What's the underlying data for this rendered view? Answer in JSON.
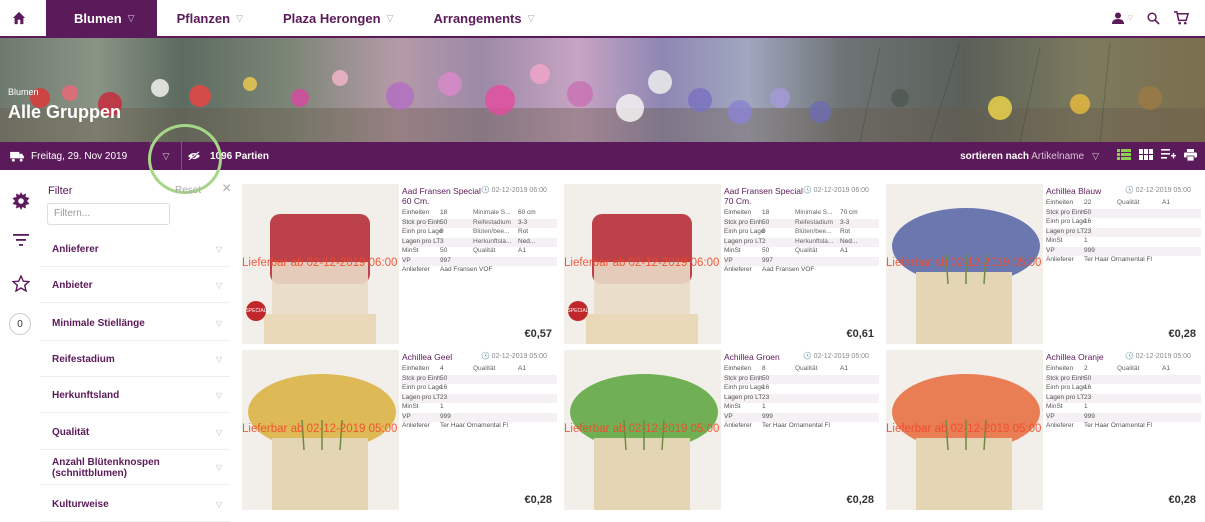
{
  "nav": {
    "items": [
      {
        "label": "Blumen",
        "active": true
      },
      {
        "label": "Pflanzen",
        "active": false
      },
      {
        "label": "Plaza Herongen",
        "active": false
      },
      {
        "label": "Arrangements",
        "active": false
      }
    ],
    "icons": [
      "home-icon",
      "user-icon",
      "search-icon",
      "cart-icon"
    ]
  },
  "banner": {
    "breadcrumb": "Blumen",
    "title": "Alle Gruppen"
  },
  "toolbar": {
    "date": "Freitag, 29. Nov 2019",
    "count": "1096 Partien",
    "sort_prefix": "sortieren nach",
    "sort_value": "Artikelname"
  },
  "filters": {
    "heading": "Filter",
    "reset": "Reset",
    "placeholder": "Filtern...",
    "badge": "0",
    "items": [
      "Anlieferer",
      "Anbieter",
      "Minimale Stiellänge",
      "Reifestadium",
      "Herkunftsland",
      "Qualität",
      "Anzahl Blütenknospen (schnittblumen)",
      "Kulturweise"
    ]
  },
  "products": [
    {
      "name": "Aad Fransen Special 60 Cm.",
      "date": "02-12-2019 06:00",
      "lieferbar": "Lieferbar ab 02-12-2019 06:00",
      "special": true,
      "rows": [
        [
          "Einheiten",
          "18",
          "Minimale S...",
          "60 cm"
        ],
        [
          "Stck pro Einh",
          "50",
          "Reifestadium",
          "3-3"
        ],
        [
          "Einh pro Lage",
          "9",
          "Blüten/bee...",
          "Rot"
        ],
        [
          "Lagen pro LT",
          "3",
          "Herkunftsla...",
          "Ned..."
        ],
        [
          "MinSt",
          "50",
          "Qualität",
          "A1"
        ],
        [
          "VP",
          "997",
          "",
          ""
        ]
      ],
      "anlieferer": "Aad Fransen VOF",
      "price": "€0,57"
    },
    {
      "name": "Aad Fransen Special 70 Cm.",
      "date": "02-12-2019 06:00",
      "lieferbar": "Lieferbar ab 02-12-2019 06:00",
      "special": true,
      "rows": [
        [
          "Einheiten",
          "18",
          "Minimale S...",
          "70 cm"
        ],
        [
          "Stck pro Einh",
          "50",
          "Reifestadium",
          "3-3"
        ],
        [
          "Einh pro Lage",
          "9",
          "Blüten/bee...",
          "Rot"
        ],
        [
          "Lagen pro LT",
          "2",
          "Herkunftsla...",
          "Ned..."
        ],
        [
          "MinSt",
          "50",
          "Qualität",
          "A1"
        ],
        [
          "VP",
          "997",
          "",
          ""
        ]
      ],
      "anlieferer": "Aad Fransen VOF",
      "price": "€0,61"
    },
    {
      "name": "Achillea Blauw",
      "date": "02-12-2019 05:00",
      "lieferbar": "Lieferbar ab 02-12-2019 05:00",
      "special": false,
      "rows": [
        [
          "Einheiten",
          "22",
          "Qualität",
          "A1"
        ],
        [
          "Stck pro Einh",
          "50",
          "",
          ""
        ],
        [
          "Einh pro Lage",
          "16",
          "",
          ""
        ],
        [
          "Lagen pro LT",
          "23",
          "",
          ""
        ],
        [
          "MinSt",
          "1",
          "",
          ""
        ],
        [
          "VP",
          "999",
          "",
          ""
        ]
      ],
      "anlieferer": "Ter Haar Ornamental Fl",
      "price": "€0,28"
    },
    {
      "name": "Achillea Geel",
      "date": "02-12-2019 05:00",
      "lieferbar": "Lieferbar ab 02-12-2019 05:00",
      "special": false,
      "rows": [
        [
          "Einheiten",
          "4",
          "Qualität",
          "A1"
        ],
        [
          "Stck pro Einh",
          "50",
          "",
          ""
        ],
        [
          "Einh pro Lage",
          "16",
          "",
          ""
        ],
        [
          "Lagen pro LT",
          "23",
          "",
          ""
        ],
        [
          "MinSt",
          "1",
          "",
          ""
        ],
        [
          "VP",
          "999",
          "",
          ""
        ]
      ],
      "anlieferer": "Ter Haar Ornamental Fl",
      "price": "€0,28"
    },
    {
      "name": "Achillea Groen",
      "date": "02-12-2019 05:00",
      "lieferbar": "Lieferbar ab 02-12-2019 05:00",
      "special": false,
      "rows": [
        [
          "Einheiten",
          "8",
          "Qualität",
          "A1"
        ],
        [
          "Stck pro Einh",
          "50",
          "",
          ""
        ],
        [
          "Einh pro Lage",
          "16",
          "",
          ""
        ],
        [
          "Lagen pro LT",
          "23",
          "",
          ""
        ],
        [
          "MinSt",
          "1",
          "",
          ""
        ],
        [
          "VP",
          "999",
          "",
          ""
        ]
      ],
      "anlieferer": "Ter Haar Ornamental Fl",
      "price": "€0,28"
    },
    {
      "name": "Achillea Oranje",
      "date": "02-12-2019 05:00",
      "lieferbar": "Lieferbar ab 02-12-2019 05:00",
      "special": false,
      "rows": [
        [
          "Einheiten",
          "2",
          "Qualität",
          "A1"
        ],
        [
          "Stck pro Einh",
          "50",
          "",
          ""
        ],
        [
          "Einh pro Lage",
          "16",
          "",
          ""
        ],
        [
          "Lagen pro LT",
          "23",
          "",
          ""
        ],
        [
          "MinSt",
          "1",
          "",
          ""
        ],
        [
          "VP",
          "999",
          "",
          ""
        ]
      ],
      "anlieferer": "Ter Haar Ornamental Fl",
      "price": "€0,28"
    }
  ],
  "labels": {
    "anlieferer": "Anlieferer"
  },
  "colors": {
    "brand": "#5b1a59",
    "lieferbar": "#f04a2b",
    "highlight": "#a6d788",
    "flower_red": "#b3222c",
    "flower_blue": "#5463a6",
    "flower_yellow": "#d9b03c",
    "flower_green": "#5aa33a",
    "flower_orange": "#e8683a"
  }
}
